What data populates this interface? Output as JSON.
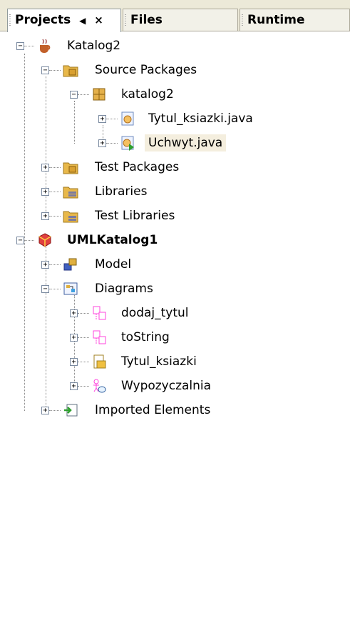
{
  "tabs": [
    {
      "label": "Projects",
      "pin": "◀",
      "close": "×"
    },
    {
      "label": "Files"
    },
    {
      "label": "Runtime"
    }
  ],
  "tree": {
    "katalog2": "Katalog2",
    "source_packages": "Source Packages",
    "pkg_katalog2": "katalog2",
    "tytul_java": "Tytul_ksiazki.java",
    "uchwyt_java": "Uchwyt.java",
    "test_packages": "Test Packages",
    "libraries": "Libraries",
    "test_libraries": "Test Libraries",
    "uml_katalog1": "UMLKatalog1",
    "model": "Model",
    "diagrams": "Diagrams",
    "dodaj_tytul": "dodaj_tytul",
    "tostring": "toString",
    "tytul_ksiazki": "Tytul_ksiazki",
    "wypozyczalnia": "Wypozyczalnia",
    "imported_elements": "Imported Elements"
  },
  "expander": {
    "plus": "+",
    "minus": "−"
  },
  "colors": {
    "selection": "#f4eede",
    "folder": "#e8b84a",
    "diagram": "#ff44dd"
  }
}
